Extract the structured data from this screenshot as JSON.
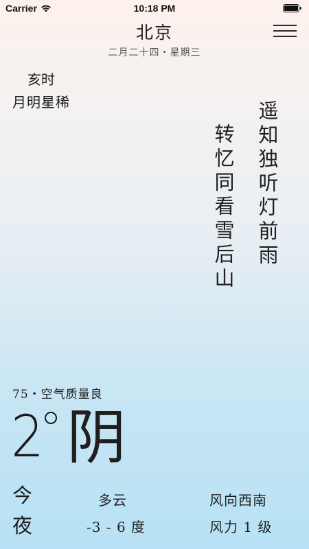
{
  "status_bar": {
    "carrier": "Carrier",
    "time": "10:18 PM"
  },
  "header": {
    "city": "北京",
    "date": "二月二十四・星期三"
  },
  "period": {
    "name": "亥时",
    "description": "月明星稀"
  },
  "poem": {
    "line1": "遥知独听灯前雨",
    "line2": "转忆同看雪后山"
  },
  "weather": {
    "aqi": "75・空气质量良",
    "temperature": "2",
    "condition": "阴"
  },
  "tonight": {
    "label": "今夜",
    "weather": "多云",
    "range": "-3 - 6 度",
    "wind_direction": "风向西南",
    "wind_level": "风力 1 级"
  }
}
